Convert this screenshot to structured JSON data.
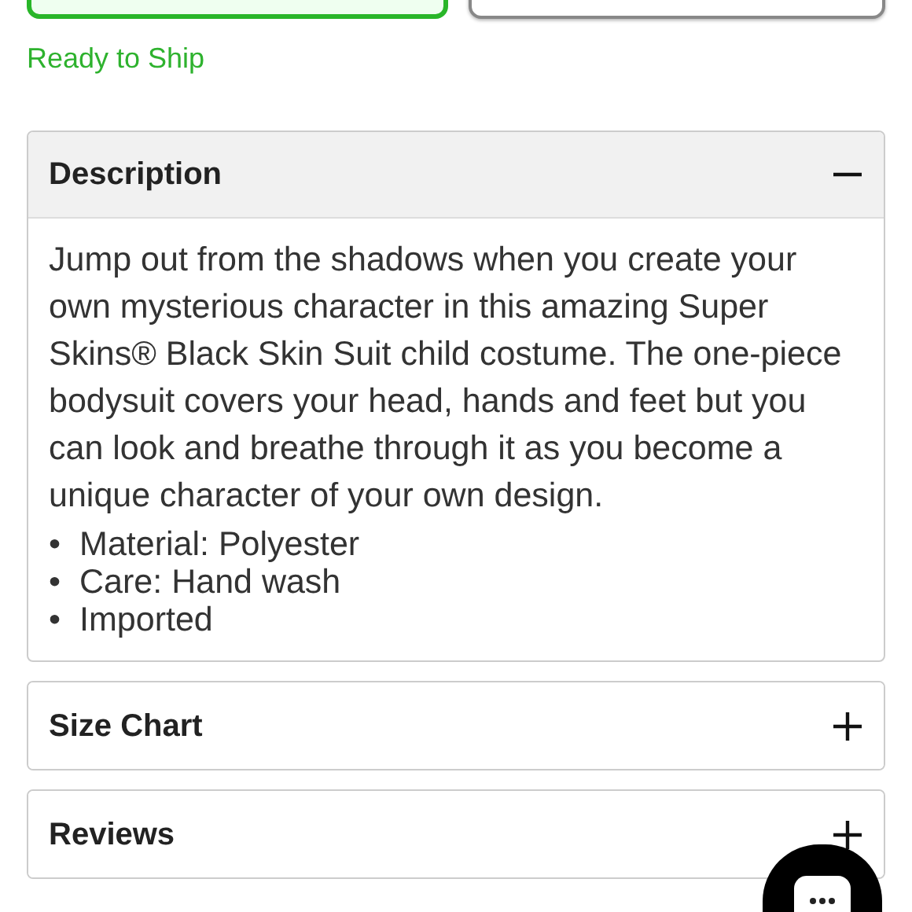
{
  "options": [
    {
      "selected": true
    },
    {
      "selected": false
    }
  ],
  "availability": "Ready to Ship",
  "sections": [
    {
      "title": "Description",
      "expanded": true,
      "paragraph": "Jump out from the shadows when you create your own mysterious character in this amazing Super Skins® Black Skin Suit child costume. The one-piece bodysuit covers your head, hands and feet but you can look and breathe through it as you become a unique character of your own design.",
      "bullets": [
        {
          "marker": "•",
          "text": "Material: Polyester"
        },
        {
          "marker": "•",
          "text": "Care: Hand wash"
        },
        {
          "marker": "•",
          "text": "Imported"
        }
      ]
    },
    {
      "title": "Size Chart",
      "expanded": false
    },
    {
      "title": "Reviews",
      "expanded": false
    }
  ]
}
